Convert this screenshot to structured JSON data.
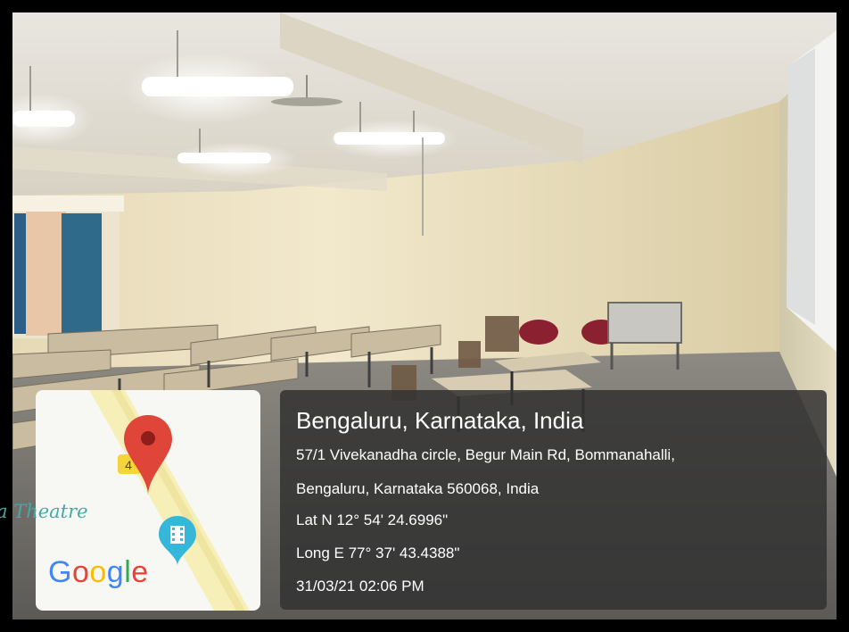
{
  "photo": {
    "scene": "classroom-interior"
  },
  "map_thumbnail": {
    "place_label": "a Theatre",
    "road_marker": "4",
    "logo_letters": [
      {
        "ch": "G",
        "color": "#4285F4"
      },
      {
        "ch": "o",
        "color": "#EA4335"
      },
      {
        "ch": "o",
        "color": "#FBBC05"
      },
      {
        "ch": "g",
        "color": "#4285F4"
      },
      {
        "ch": "l",
        "color": "#34A853"
      },
      {
        "ch": "e",
        "color": "#EA4335"
      }
    ],
    "pin_icon": "map-pin-icon",
    "poi_icon": "film-poi-icon",
    "colors": {
      "pin": "#e0453a",
      "poi": "#36b6d8",
      "road": "#f6f0b8"
    }
  },
  "location": {
    "title": "Bengaluru, Karnataka, India",
    "address_line1": "57/1 Vivekanadha circle, Begur Main Rd, Bommanahalli,",
    "address_line2": "Bengaluru, Karnataka 560068, India",
    "latitude": "Lat N 12° 54' 24.6996\"",
    "longitude": "Long E 77° 37' 43.4388\"",
    "datetime": "31/03/21 02:06 PM"
  }
}
